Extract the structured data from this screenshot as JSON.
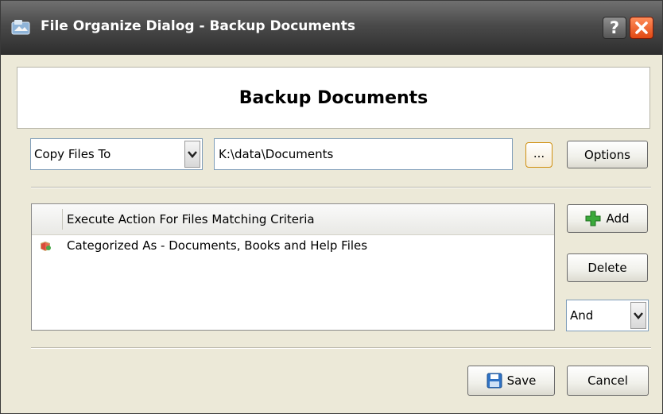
{
  "window": {
    "title": "File Organize Dialog - Backup Documents"
  },
  "header": {
    "title": "Backup Documents"
  },
  "action": {
    "selected": "Copy Files To",
    "destination": "K:\\data\\Documents",
    "browse_label": "...",
    "options_label": "Options"
  },
  "criteria": {
    "column_header": "Execute Action For Files Matching Criteria",
    "rows": [
      {
        "label": "Categorized As - Documents, Books and Help Files"
      }
    ]
  },
  "side": {
    "add_label": "Add",
    "delete_label": "Delete",
    "logic_selected": "And"
  },
  "footer": {
    "save_label": "Save",
    "cancel_label": "Cancel"
  },
  "colors": {
    "titlebar": "#3d3d3d",
    "close": "#e35a24",
    "background": "#ece9d8",
    "browse_border": "#d09010",
    "add_icon": "#3aa93a",
    "save_icon": "#2f72c4"
  },
  "icons": [
    "app-icon",
    "help-icon",
    "close-icon",
    "dropdown-arrow-icon",
    "category-icon",
    "add-icon",
    "save-icon"
  ]
}
